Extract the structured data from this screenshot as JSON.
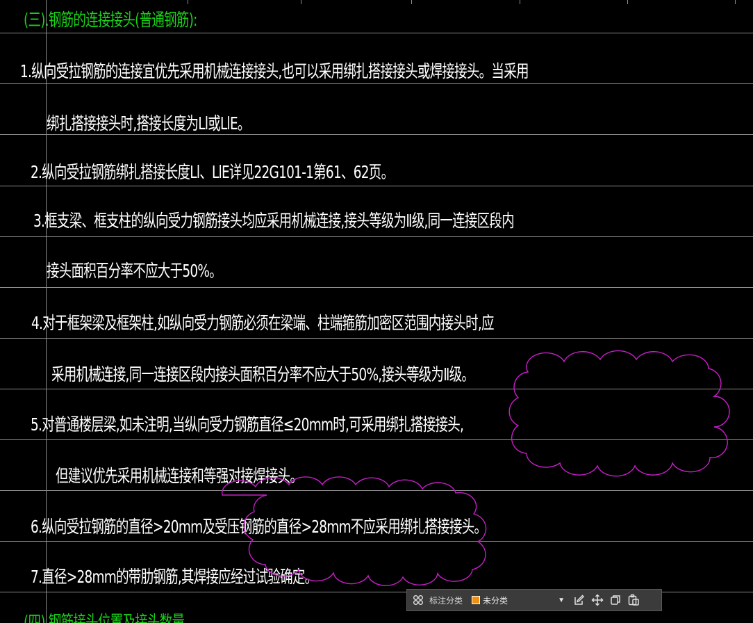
{
  "drawing": {
    "heading": "(三).钢筋的连接接头(普通钢筋):",
    "lines": [
      "1.纵向受拉钢筋的连接宜优先采用机械连接接头,也可以采用绑扎搭接接头或焊接接头。当采用",
      "绑扎搭接接头时,搭接长度为Ll或LlE。",
      "2.纵向受拉钢筋绑扎搭接长度Ll、LlE详见22G101-1第61、62页。",
      "3.框支梁、框支柱的纵向受力钢筋接头均应采用机械连接,接头等级为Ⅱ级,同一连接区段内",
      "接头面积百分率不应大于50%。",
      "4.对于框架梁及框架柱,如纵向受力钢筋必须在梁端、柱端箍筋加密区范围内接头时,应",
      "采用机械连接,同一连接区段内接头面积百分率不应大于50%,接头等级为Ⅱ级。",
      "5.对普通楼层梁,如未注明,当纵向受力钢筋直径≤20mm时,可采用绑扎搭接接头,",
      "但建议优先采用机械连接和等强对接焊接头。",
      "6.纵向受拉钢筋的直径>20mm及受压钢筋的直径>28mm不应采用绑扎搭接接头。",
      "7.直径>28mm的带肋钢筋,其焊接应经过试验确定。"
    ],
    "footer_heading": "(四).钢筋接头位置及接头数量",
    "colors": {
      "background": "#000000",
      "text": "#ffffff",
      "heading": "#19d219",
      "revision_cloud": "#c81ec8",
      "grid": "#8e8e8e"
    }
  },
  "toolbar": {
    "grid_icon": "grid-icon",
    "label": "标注分类",
    "category_value": "未分类",
    "category_color": "#f0900e",
    "dropdown_icon": "chevron-down-icon",
    "tools": [
      "edit-icon",
      "move-icon",
      "copy-icon",
      "paste-icon"
    ]
  }
}
